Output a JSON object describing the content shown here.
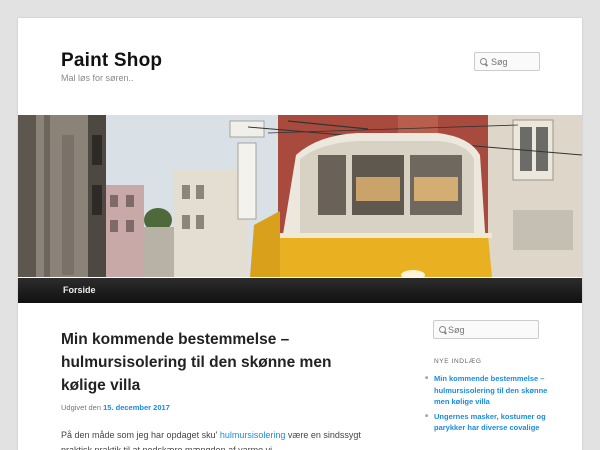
{
  "site": {
    "title": "Paint Shop",
    "description": "Mal løs for søren.."
  },
  "search": {
    "placeholder": "Søg"
  },
  "nav": {
    "items": [
      "Forside"
    ]
  },
  "post": {
    "title": "Min kommende bestemmelse – hulmursisolering til den skønne men kølige villa",
    "meta_prefix": "Udgivet den",
    "date": "15. december 2017",
    "content_start": "På den måde som jeg har opdaget sku'",
    "content_link": "hulmursisolering",
    "content_rest": "være en sindssygt praktisk praktik til at nedskære mængden af varme vi"
  },
  "sidebar": {
    "search_placeholder": "Søg",
    "recent_title": "NYE INDLÆG",
    "recent": [
      "Min kommende bestemmelse – hulmursisolering til den skønne men kølige villa",
      "Ungernes masker, kostumer og parykker har diverse covalige"
    ]
  },
  "colors": {
    "link": "#1b8be0",
    "nav_bg": "#1a1a1a",
    "tram_yellow": "#e9b021"
  }
}
